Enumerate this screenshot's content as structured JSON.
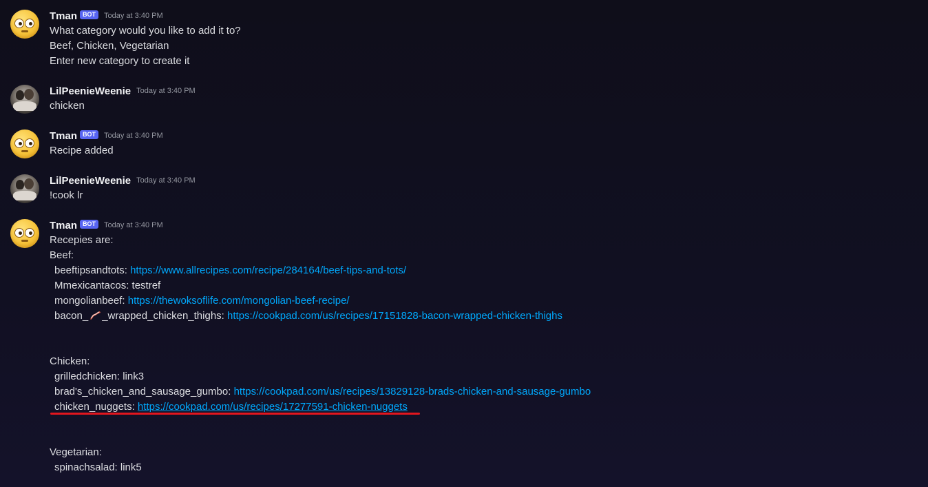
{
  "messages": [
    {
      "author": "Tman",
      "bot_tag": "BOT",
      "timestamp": "Today at 3:40 PM",
      "lines": [
        "What category would you like to add it to?",
        "Beef, Chicken, Vegetarian",
        "Enter new category to create it"
      ]
    },
    {
      "author": "LilPeenieWeenie",
      "timestamp": "Today at 3:40 PM",
      "lines": [
        "chicken"
      ]
    },
    {
      "author": "Tman",
      "bot_tag": "BOT",
      "timestamp": "Today at 3:40 PM",
      "lines": [
        "Recipe added"
      ]
    },
    {
      "author": "LilPeenieWeenie",
      "timestamp": "Today at 3:40 PM",
      "lines": [
        "!cook lr"
      ]
    },
    {
      "author": "Tman",
      "bot_tag": "BOT",
      "timestamp": "Today at 3:40 PM",
      "intro": "Recepies are:",
      "categories": [
        {
          "name": "Beef:",
          "entries": [
            {
              "label": "beeftipsandtots: ",
              "link": "https://www.allrecipes.com/recipe/284164/beef-tips-and-tots/"
            },
            {
              "label": "Mmexicantacos: testref"
            },
            {
              "label": "mongolianbeef: ",
              "link": "https://thewoksoflife.com/mongolian-beef-recipe/"
            },
            {
              "label_pre": "bacon_",
              "label_emoji": "bacon-emoji-icon",
              "label_post": "_wrapped_chicken_thighs: ",
              "link": "https://cookpad.com/us/recipes/17151828-bacon-wrapped-chicken-thighs"
            }
          ]
        },
        {
          "name": "Chicken:",
          "entries": [
            {
              "label": "grilledchicken: link3"
            },
            {
              "label": "brad's_chicken_and_sausage_gumbo: ",
              "link": "https://cookpad.com/us/recipes/13829128-brads-chicken-and-sausage-gumbo"
            },
            {
              "label": "chicken_nuggets: ",
              "link": "https://cookpad.com/us/recipes/17277591-chicken-nuggets"
            }
          ]
        },
        {
          "name": "Vegetarian:",
          "entries": [
            {
              "label": "spinachsalad: link5"
            }
          ]
        }
      ]
    }
  ],
  "colors": {
    "link": "#00a8fc",
    "bot_tag": "#5865f2",
    "highlight_underline": "#e3161e"
  }
}
